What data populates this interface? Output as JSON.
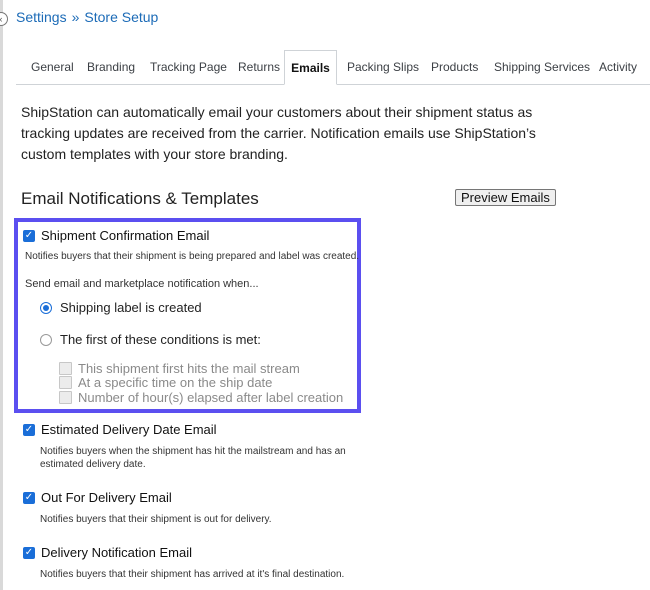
{
  "breadcrumb": {
    "items": [
      "Settings",
      "Store Setup"
    ],
    "separator": "»"
  },
  "tabs": [
    {
      "label": "General",
      "active": false
    },
    {
      "label": "Branding",
      "active": false
    },
    {
      "label": "Tracking Page",
      "active": false
    },
    {
      "label": "Returns",
      "active": false
    },
    {
      "label": "Emails",
      "active": true
    },
    {
      "label": "Packing Slips",
      "active": false
    },
    {
      "label": "Products",
      "active": false
    },
    {
      "label": "Shipping Services",
      "active": false
    },
    {
      "label": "Activity",
      "active": false
    }
  ],
  "intro": "ShipStation can automatically email your customers about their shipment status as tracking updates are received from the carrier. Notification emails use ShipStation’s custom templates with your store branding.",
  "section": {
    "title": "Email Notifications & Templates",
    "preview_button": "Preview Emails"
  },
  "emails": {
    "shipment_confirmation": {
      "label": "Shipment Confirmation Email",
      "checked": true,
      "description": "Notifies buyers that their shipment is being prepared and label was created.",
      "send_when_label": "Send email and marketplace notification when...",
      "options": {
        "label_created": {
          "label": "Shipping label is created",
          "selected": true
        },
        "first_condition": {
          "label": "The first of these conditions is met:",
          "selected": false
        }
      },
      "conditions": [
        {
          "label": "This shipment first hits the mail stream",
          "checked": false
        },
        {
          "label": "At a specific time on the ship date",
          "checked": false
        },
        {
          "label": "Number of hour(s) elapsed after label creation",
          "checked": false
        }
      ]
    },
    "estimated_delivery": {
      "label": "Estimated Delivery Date Email",
      "checked": true,
      "description": "Notifies buyers when the shipment has hit the mailstream and has an estimated delivery date."
    },
    "out_for_delivery": {
      "label": "Out For Delivery Email",
      "checked": true,
      "description": "Notifies buyers that their shipment is out for delivery."
    },
    "delivery_notification": {
      "label": "Delivery Notification Email",
      "checked": true,
      "description": "Notifies buyers that their shipment has arrived at it's final destination."
    }
  },
  "icons": {
    "check": "✓"
  },
  "colors": {
    "link": "#1c6bb7",
    "accent": "#1a6ed8",
    "highlight": "#5b4ff0"
  }
}
